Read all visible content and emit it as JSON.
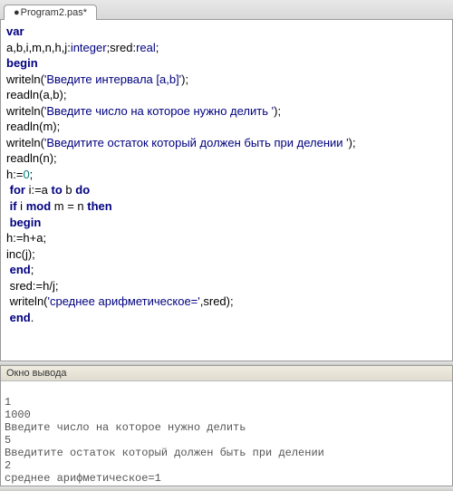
{
  "tab": {
    "label": "Program2.pas",
    "modified": "*"
  },
  "code": {
    "l1_kw": "var",
    "l2a": "a,b,i,m,n,h,j:",
    "l2b": "integer",
    "l2c": ";sred:",
    "l2d": "real",
    "l2e": ";",
    "l3_kw": "begin",
    "l4a": "writeln(",
    "l4b": "'Введите интервала [a,b]'",
    "l4c": ");",
    "l5": "readln(a,b);",
    "l6a": "writeln(",
    "l6b": "'Введите число на которое нужно делить '",
    "l6c": ");",
    "l7": "readln(m);",
    "l8a": "writeln(",
    "l8b": "'Введитите остаток который должен быть при делении '",
    "l8c": ");",
    "l9": "readln(n);",
    "l10a": "h:=",
    "l10b": "0",
    "l10c": ";",
    "l11a": " for",
    "l11b": " i:=a ",
    "l11c": "to",
    "l11d": " b ",
    "l11e": "do",
    "l12a": " if",
    "l12b": " i ",
    "l12c": "mod",
    "l12d": " m = n ",
    "l12e": "then",
    "l13": " begin",
    "l14": "h:=h+a;",
    "l15": "inc(j);",
    "l16": " end",
    "l16b": ";",
    "l17": " sred:=h/j;",
    "l18a": " writeln(",
    "l18b": "'среднее арифметическое='",
    "l18c": ",sred);",
    "l19": " end",
    "l19b": "."
  },
  "output": {
    "title": "Окно вывода",
    "lines": [
      "1",
      "1000",
      "Введите число на которое нужно делить",
      "5",
      "Введитите остаток который должен быть при делении",
      "2",
      "среднее арифметическое=1"
    ]
  }
}
